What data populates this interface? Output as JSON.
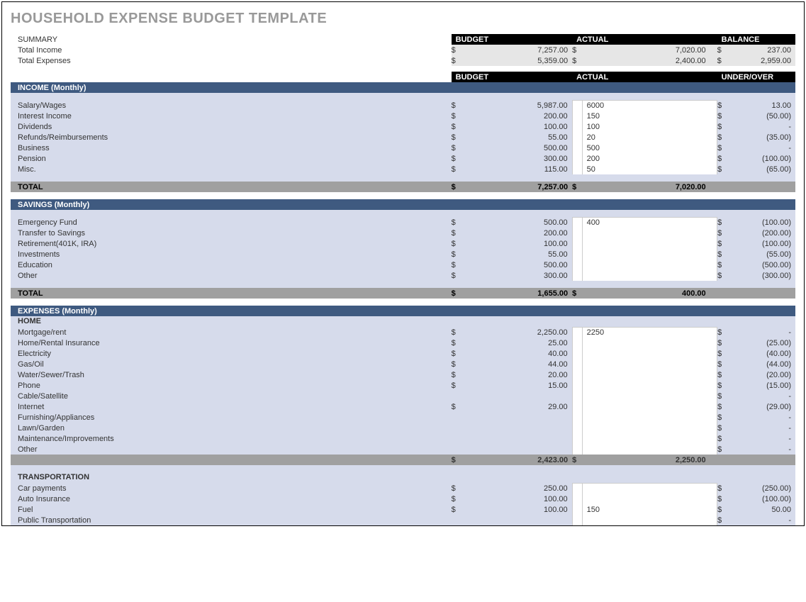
{
  "title": "HOUSEHOLD EXPENSE BUDGET TEMPLATE",
  "summary": {
    "label": "SUMMARY",
    "hdr_budget": "BUDGET",
    "hdr_actual": "ACTUAL",
    "hdr_balance": "BALANCE",
    "rows": [
      {
        "label": "Total Income",
        "budget": "7,257.00",
        "actual": "7,020.00",
        "balance": "237.00"
      },
      {
        "label": "Total Expenses",
        "budget": "5,359.00",
        "actual": "2,400.00",
        "balance": "2,959.00"
      }
    ]
  },
  "colhdr": {
    "budget": "BUDGET",
    "actual": "ACTUAL",
    "under": "UNDER/OVER"
  },
  "income": {
    "title": "INCOME (Monthly)",
    "rows": [
      {
        "label": "Salary/Wages",
        "budget": "5,987.00",
        "actual": "6000",
        "uo": "13.00",
        "neg": false
      },
      {
        "label": "Interest Income",
        "budget": "200.00",
        "actual": "150",
        "uo": "50.00",
        "neg": true
      },
      {
        "label": "Dividends",
        "budget": "100.00",
        "actual": "100",
        "uo": "-",
        "neg": false
      },
      {
        "label": "Refunds/Reimbursements",
        "budget": "55.00",
        "actual": "20",
        "uo": "35.00",
        "neg": true
      },
      {
        "label": "Business",
        "budget": "500.00",
        "actual": "500",
        "uo": "-",
        "neg": false
      },
      {
        "label": "Pension",
        "budget": "300.00",
        "actual": "200",
        "uo": "100.00",
        "neg": true
      },
      {
        "label": "Misc.",
        "budget": "115.00",
        "actual": "50",
        "uo": "65.00",
        "neg": true
      }
    ],
    "total_label": "TOTAL",
    "total_budget": "7,257.00",
    "total_actual": "7,020.00"
  },
  "savings": {
    "title": "SAVINGS (Monthly)",
    "rows": [
      {
        "label": "Emergency Fund",
        "budget": "500.00",
        "actual": "400",
        "uo": "100.00",
        "neg": true
      },
      {
        "label": "Transfer to Savings",
        "budget": "200.00",
        "actual": "",
        "uo": "200.00",
        "neg": true
      },
      {
        "label": "Retirement(401K, IRA)",
        "budget": "100.00",
        "actual": "",
        "uo": "100.00",
        "neg": true
      },
      {
        "label": "Investments",
        "budget": "55.00",
        "actual": "",
        "uo": "55.00",
        "neg": true
      },
      {
        "label": "Education",
        "budget": "500.00",
        "actual": "",
        "uo": "500.00",
        "neg": true
      },
      {
        "label": "Other",
        "budget": "300.00",
        "actual": "",
        "uo": "300.00",
        "neg": true
      }
    ],
    "total_label": "TOTAL",
    "total_budget": "1,655.00",
    "total_actual": "400.00"
  },
  "expenses": {
    "title": "EXPENSES (Monthly)",
    "home": {
      "title": "HOME",
      "rows": [
        {
          "label": "Mortgage/rent",
          "budget": "2,250.00",
          "actual": "2250",
          "uo": "-",
          "neg": false
        },
        {
          "label": "Home/Rental Insurance",
          "budget": "25.00",
          "actual": "",
          "uo": "25.00",
          "neg": true
        },
        {
          "label": "Electricity",
          "budget": "40.00",
          "actual": "",
          "uo": "40.00",
          "neg": true
        },
        {
          "label": "Gas/Oil",
          "budget": "44.00",
          "actual": "",
          "uo": "44.00",
          "neg": true
        },
        {
          "label": "Water/Sewer/Trash",
          "budget": "20.00",
          "actual": "",
          "uo": "20.00",
          "neg": true
        },
        {
          "label": "Phone",
          "budget": "15.00",
          "actual": "",
          "uo": "15.00",
          "neg": true
        },
        {
          "label": "Cable/Satellite",
          "budget": "",
          "actual": "",
          "uo": "-",
          "neg": false
        },
        {
          "label": "Internet",
          "budget": "29.00",
          "actual": "",
          "uo": "29.00",
          "neg": true
        },
        {
          "label": "Furnishing/Appliances",
          "budget": "",
          "actual": "",
          "uo": "-",
          "neg": false
        },
        {
          "label": "Lawn/Garden",
          "budget": "",
          "actual": "",
          "uo": "-",
          "neg": false
        },
        {
          "label": "Maintenance/Improvements",
          "budget": "",
          "actual": "",
          "uo": "-",
          "neg": false
        },
        {
          "label": "Other",
          "budget": "",
          "actual": "",
          "uo": "-",
          "neg": false
        }
      ],
      "sub_budget": "2,423.00",
      "sub_actual": "2,250.00"
    },
    "transportation": {
      "title": "TRANSPORTATION",
      "rows": [
        {
          "label": "Car payments",
          "budget": "250.00",
          "actual": "",
          "uo": "250.00",
          "neg": true
        },
        {
          "label": "Auto Insurance",
          "budget": "100.00",
          "actual": "",
          "uo": "100.00",
          "neg": true
        },
        {
          "label": "Fuel",
          "budget": "100.00",
          "actual": "150",
          "uo": "50.00",
          "neg": false
        },
        {
          "label": "Public Transportation",
          "budget": "",
          "actual": "",
          "uo": "-",
          "neg": false
        }
      ]
    }
  },
  "sym": "$"
}
